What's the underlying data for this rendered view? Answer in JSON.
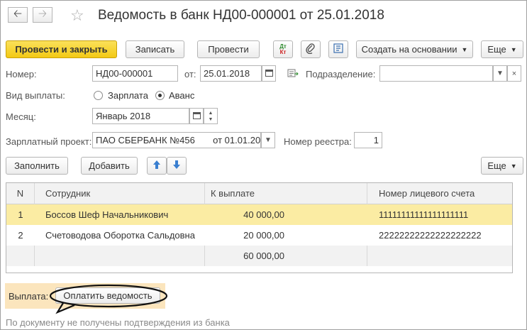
{
  "window": {
    "title": "Ведомость в банк НД00-000001 от 25.01.2018"
  },
  "toolbar": {
    "post_and_close": "Провести и закрыть",
    "save": "Записать",
    "post": "Провести",
    "dtkt_top": "Дт",
    "dtkt_bottom": "Кт",
    "create_based_on": "Создать на основании",
    "more": "Еще"
  },
  "form": {
    "number_label": "Номер:",
    "number_value": "НД00-000001",
    "date_label": "от:",
    "date_value": "25.01.2018",
    "division_label": "Подразделение:",
    "division_value": "",
    "payment_type_label": "Вид выплаты:",
    "payment_type_options": [
      "Зарплата",
      "Аванс"
    ],
    "payment_type_selected": "Аванс",
    "month_label": "Месяц:",
    "month_value": "Январь 2018",
    "salary_project_label": "Зарплатный проект:",
    "salary_project_value": "ПАО СБЕРБАНК №456       от 01.01.20",
    "registry_label": "Номер реестра:",
    "registry_value": "1"
  },
  "table_toolbar": {
    "fill": "Заполнить",
    "add": "Добавить",
    "more": "Еще"
  },
  "table": {
    "columns": [
      "N",
      "Сотрудник",
      "К выплате",
      "Номер лицевого счета"
    ],
    "rows": [
      {
        "n": "1",
        "employee": "Боссов Шеф Начальникович",
        "amount": "40 000,00",
        "account": "11111111111111111111"
      },
      {
        "n": "2",
        "employee": "Счетоводова Оборотка Сальдовна",
        "amount": "20 000,00",
        "account": "22222222222222222222"
      }
    ],
    "total": "60 000,00"
  },
  "footer": {
    "payment_label": "Выплата:",
    "pay_button": "Оплатить ведомость",
    "status": "По документу не получены подтверждения из банка"
  },
  "colors": {
    "primary": "#f3c914",
    "selected_row": "#fbeca3",
    "status_text": "#8a8a8a"
  }
}
